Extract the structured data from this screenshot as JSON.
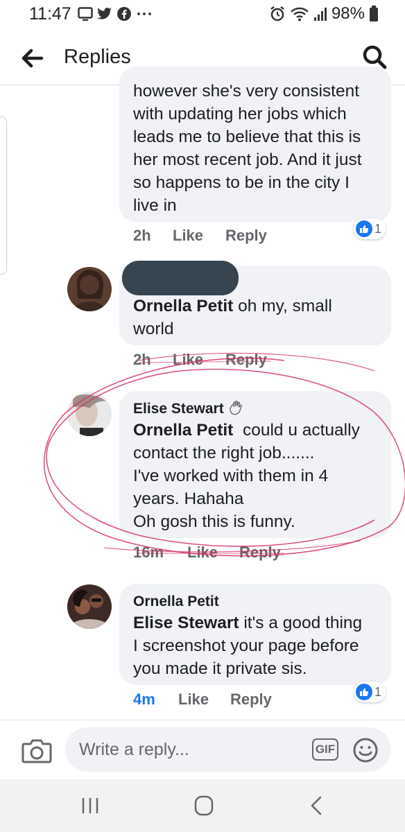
{
  "status_bar": {
    "time": "11:47",
    "battery": "98%"
  },
  "header": {
    "title": "Replies"
  },
  "comments": [
    {
      "text": "however she's very consistent\nwith updating her jobs which\nleads me to believe that this is\nher most recent job. And it just\nso happens to be in the city I\nlive in",
      "time": "2h",
      "like": "Like",
      "reply": "Reply",
      "reactions": "1"
    },
    {
      "mention": "Ornella Petit",
      "text_line1": " oh my, small",
      "text_rest": "world",
      "time": "2h",
      "like": "Like",
      "reply": "Reply"
    },
    {
      "author": "Elise Stewart",
      "mention": "Ornella Petit",
      "text_line1": "  could u actually",
      "text_rest": "contact the right job.......\nI've worked with them in 4\nyears. Hahaha\nOh gosh this is funny.",
      "time": "16m",
      "like": "Like",
      "reply": "Reply"
    },
    {
      "author": "Ornella Petit",
      "mention": "Elise Stewart",
      "text_line1": " it's a good thing",
      "text_rest": "I screenshot your page before\nyou made it private sis.",
      "time": "4m",
      "like": "Like",
      "reply": "Reply",
      "reactions": "1"
    }
  ],
  "composer": {
    "placeholder": "Write a reply...",
    "gif_label": "GIF"
  },
  "icons": [
    "back-arrow-icon",
    "search-icon",
    "camera-icon",
    "emoji-icon",
    "wave-icon",
    "thumbs-up-icon",
    "recent-apps-icon",
    "home-icon",
    "back-nav-icon"
  ],
  "colors": {
    "accent": "#1877f2",
    "bubble": "#f0f2f5",
    "annotation": "#d6336c",
    "redaction": "#36454f"
  }
}
